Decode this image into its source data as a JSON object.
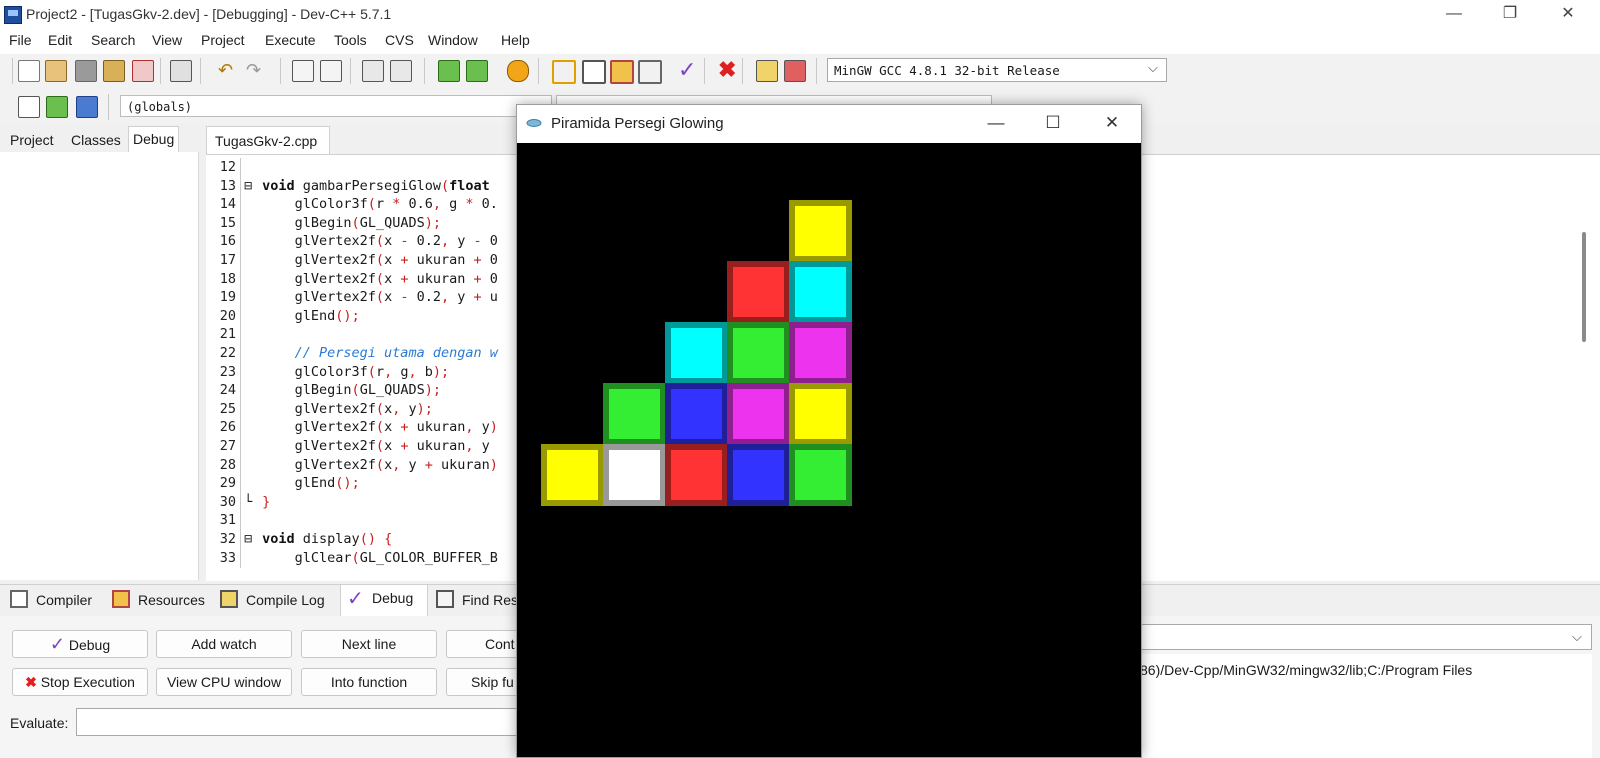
{
  "window": {
    "title": "Project2 - [TugasGkv-2.dev] - [Debugging] - Dev-C++ 5.7.1",
    "controls": [
      "—",
      "❐",
      "✕"
    ]
  },
  "menu": [
    "File",
    "Edit",
    "Search",
    "View",
    "Project",
    "Execute",
    "Tools",
    "CVS",
    "Window",
    "Help"
  ],
  "toolbar": {
    "compiler": "MinGW GCC 4.8.1 32-bit Release",
    "globals": "(globals)",
    "dropdown_arrow": "⌵"
  },
  "left_tabs": [
    "Project",
    "Classes",
    "Debug"
  ],
  "editor": {
    "file_tab": "TugasGkv-2.cpp",
    "lines": [
      {
        "n": "12",
        "text": ""
      },
      {
        "n": "13",
        "text": "void gambarPersegiGlow(float"
      },
      {
        "n": "14",
        "text": "    glColor3f(r * 0.6, g * 0."
      },
      {
        "n": "15",
        "text": "    glBegin(GL_QUADS);"
      },
      {
        "n": "16",
        "text": "    glVertex2f(x - 0.2, y - 0"
      },
      {
        "n": "17",
        "text": "    glVertex2f(x + ukuran + 0"
      },
      {
        "n": "18",
        "text": "    glVertex2f(x + ukuran + 0"
      },
      {
        "n": "19",
        "text": "    glVertex2f(x - 0.2, y + u"
      },
      {
        "n": "20",
        "text": "    glEnd();"
      },
      {
        "n": "21",
        "text": ""
      },
      {
        "n": "22",
        "text": "    // Persegi utama dengan w"
      },
      {
        "n": "23",
        "text": "    glColor3f(r, g, b);"
      },
      {
        "n": "24",
        "text": "    glBegin(GL_QUADS);"
      },
      {
        "n": "25",
        "text": "    glVertex2f(x, y);"
      },
      {
        "n": "26",
        "text": "    glVertex2f(x + ukuran, y)"
      },
      {
        "n": "27",
        "text": "    glVertex2f(x + ukuran, y"
      },
      {
        "n": "28",
        "text": "    glVertex2f(x, y + ukuran)"
      },
      {
        "n": "29",
        "text": "    glEnd();"
      },
      {
        "n": "30",
        "text": "}"
      },
      {
        "n": "31",
        "text": ""
      },
      {
        "n": "32",
        "text": "void display() {"
      },
      {
        "n": "33",
        "text": "    glClear(GL_COLOR_BUFFER_B"
      }
    ]
  },
  "bottom_tabs": [
    "Compiler",
    "Resources",
    "Compile Log",
    "Debug",
    "Find Res"
  ],
  "debug_buttons": {
    "debug": "Debug",
    "add_watch": "Add watch",
    "next_line": "Next line",
    "cont": "Cont",
    "stop": "Stop Execution",
    "cpu": "View CPU window",
    "into": "Into function",
    "skip": "Skip fu"
  },
  "evaluate_label": "Evaluate:",
  "log_text": "86)/Dev-Cpp/MinGW32/mingw32/lib;C:/Program Files",
  "gl_window": {
    "title": "Piramida Persegi Glowing",
    "controls": [
      "—",
      "☐",
      "✕"
    ],
    "cells": [
      {
        "row": 0,
        "col": 4,
        "fill": "#ffff00",
        "glow": "#999900"
      },
      {
        "row": 1,
        "col": 3,
        "fill": "#ff3333",
        "glow": "#991f1f"
      },
      {
        "row": 1,
        "col": 4,
        "fill": "#00ffff",
        "glow": "#009999"
      },
      {
        "row": 2,
        "col": 2,
        "fill": "#00ffff",
        "glow": "#009999"
      },
      {
        "row": 2,
        "col": 3,
        "fill": "#33ee33",
        "glow": "#1f8f1f"
      },
      {
        "row": 2,
        "col": 4,
        "fill": "#ee33ee",
        "glow": "#8f1f8f"
      },
      {
        "row": 3,
        "col": 1,
        "fill": "#33ee33",
        "glow": "#1f8f1f"
      },
      {
        "row": 3,
        "col": 2,
        "fill": "#3333ff",
        "glow": "#1f1f99"
      },
      {
        "row": 3,
        "col": 3,
        "fill": "#ee33ee",
        "glow": "#8f1f8f"
      },
      {
        "row": 3,
        "col": 4,
        "fill": "#ffff00",
        "glow": "#999900"
      },
      {
        "row": 4,
        "col": 0,
        "fill": "#ffff00",
        "glow": "#999900"
      },
      {
        "row": 4,
        "col": 1,
        "fill": "#ffffff",
        "glow": "#999999"
      },
      {
        "row": 4,
        "col": 2,
        "fill": "#ff3333",
        "glow": "#991f1f"
      },
      {
        "row": 4,
        "col": 3,
        "fill": "#3333ff",
        "glow": "#1f1f99"
      },
      {
        "row": 4,
        "col": 4,
        "fill": "#33ee33",
        "glow": "#1f8f1f"
      }
    ]
  }
}
